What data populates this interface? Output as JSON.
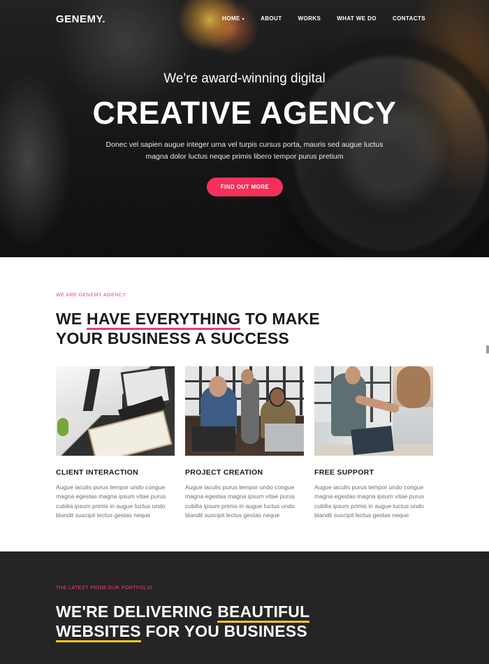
{
  "nav": {
    "logo": "GENEMY.",
    "items": [
      {
        "label": "HOME",
        "has_dropdown": true
      },
      {
        "label": "ABOUT"
      },
      {
        "label": "WORKS"
      },
      {
        "label": "WHAT WE DO"
      },
      {
        "label": "CONTACTS"
      }
    ]
  },
  "hero": {
    "subtitle": "We're award-winning digital",
    "title": "CREATIVE AGENCY",
    "description": "Donec vel sapien augue integer urna vel turpis cursus porta, mauris sed augue luctus magna dolor luctus neque primis libero tempor purus pretium",
    "cta": "FIND OUT MORE"
  },
  "about": {
    "eyebrow": "WE ARE GENEMY AGENCY",
    "heading_pre": "WE ",
    "heading_highlight": "HAVE EVERYTHING",
    "heading_mid": " TO MAKE",
    "heading_line2": "YOUR BUSINESS A SUCCESS",
    "cards": [
      {
        "title": "CLIENT INTERACTION",
        "text": "Augue iaculis purus tempor undo congue magna egestas magna ipsum vitae purus cubilia ipsum primis in augue luctus undo blandit suscipit lectus gestas neque"
      },
      {
        "title": "PROJECT CREATION",
        "text": "Augue iaculis purus tempor undo congue magna egestas magna ipsum vitae purus cubilia ipsum primis in augue luctus undo blandit suscipit lectus gestas neque"
      },
      {
        "title": "FREE SUPPORT",
        "text": "Augue iaculis purus tempor undo congue magna egestas magna ipsum vitae purus cubilia ipsum primis in augue luctus undo blandit suscipit lectus gestas neque"
      }
    ]
  },
  "portfolio": {
    "eyebrow": "THE LATEST FROM OUR PORTFOLIO",
    "heading_pre": "WE'RE DELIVERING ",
    "heading_highlight1": "BEAUTIFUL",
    "heading_highlight2": "WEBSITES",
    "heading_post": " FOR YOU BUSINESS"
  },
  "colors": {
    "accent": "#f72f5d",
    "highlight_pink": "#e83e72",
    "highlight_yellow": "#f5cd17",
    "dark_bg": "#252525"
  }
}
